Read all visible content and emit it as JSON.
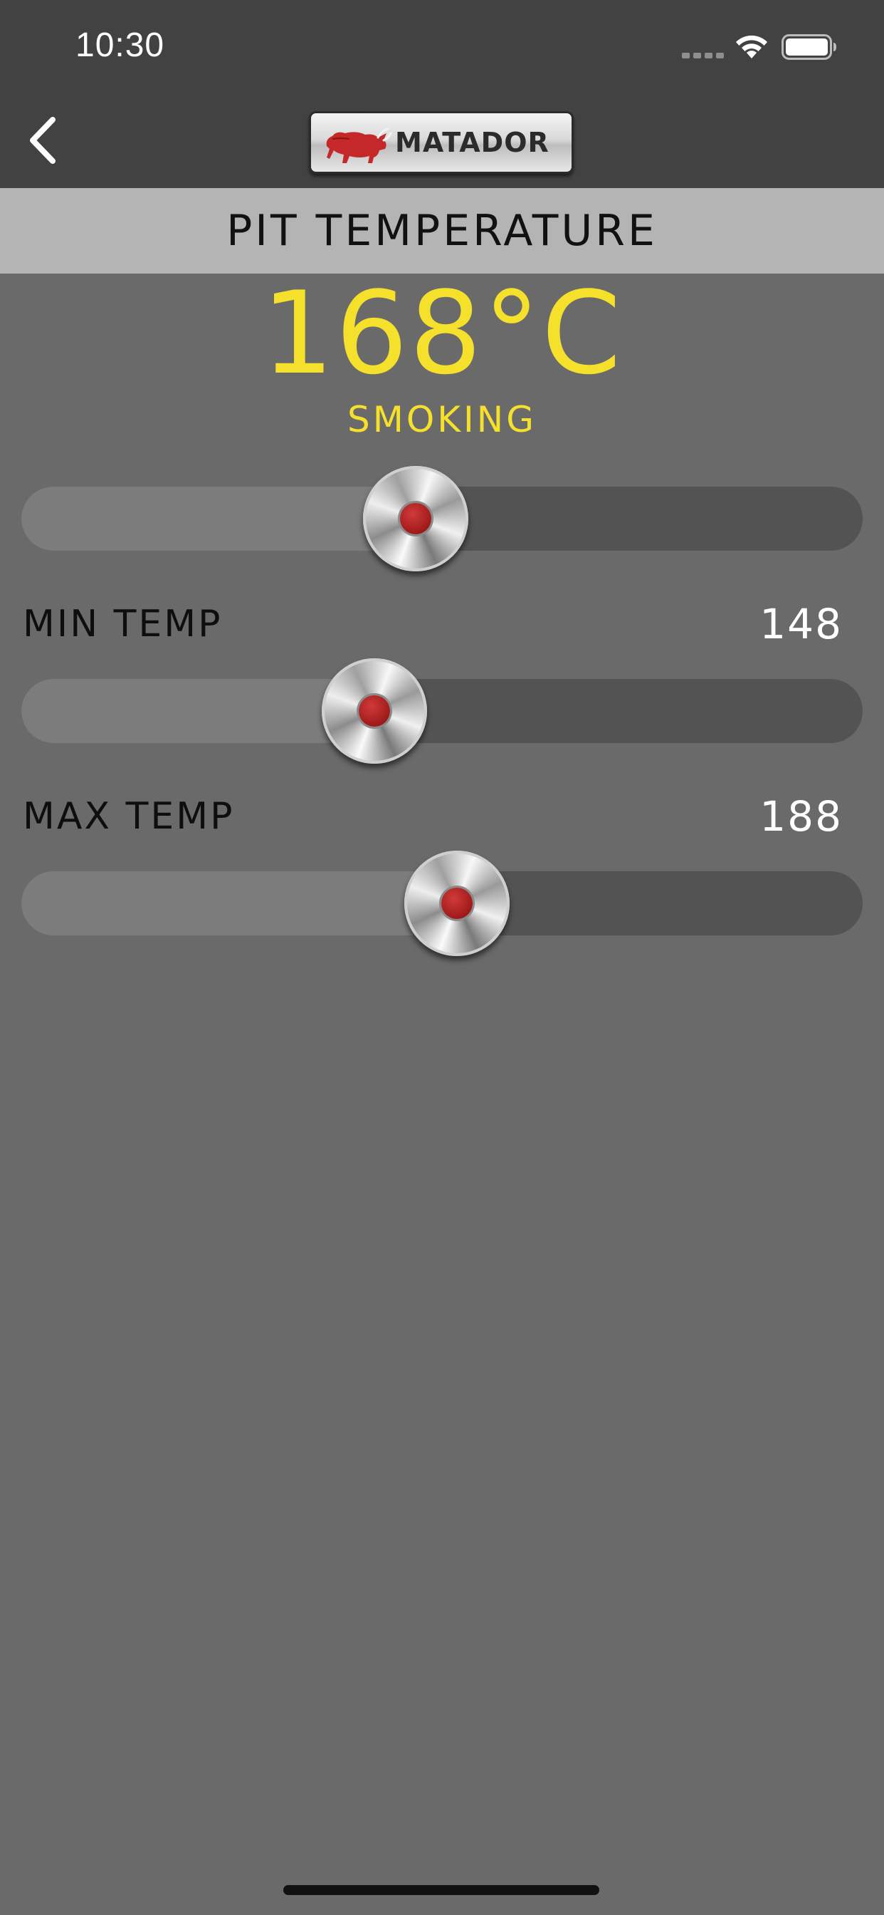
{
  "status_bar": {
    "time": "10:30",
    "wifi_icon": "wifi-icon",
    "battery_icon": "battery-icon"
  },
  "header": {
    "back_icon": "chevron-left-icon",
    "logo_text": "MATADOR"
  },
  "title_bar": {
    "title": "PIT TEMPERATURE"
  },
  "main": {
    "current_temp": "168°C",
    "mode": "SMOKING",
    "pit_slider_fraction": 0.469,
    "min": {
      "label": "MIN TEMP",
      "value": "148",
      "slider_fraction": 0.42
    },
    "max": {
      "label": "MAX TEMP",
      "value": "188",
      "slider_fraction": 0.518
    }
  },
  "colors": {
    "header_bg": "#424242",
    "title_bar_bg": "#b4b4b4",
    "body_bg": "#6a6a6a",
    "accent_yellow": "#f5e12b",
    "thumb_red": "#b02222"
  }
}
